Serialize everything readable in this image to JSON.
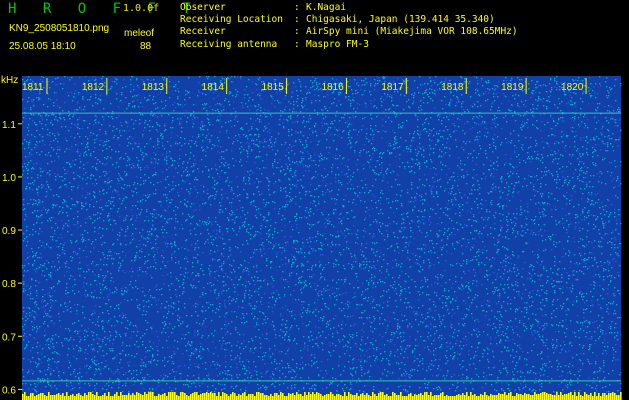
{
  "header": {
    "brand": "H R O F F T",
    "version": "1.0.0f",
    "file_name": "KN9_2508051810.png",
    "mode": "meleof",
    "datetime": "25.08.05 18:10",
    "count": "88"
  },
  "station": [
    {
      "key": "Observer",
      "value": "K.Nagai"
    },
    {
      "key": "Receiving Location",
      "value": "Chigasaki, Japan (139.414 35.340)"
    },
    {
      "key": "Receiver",
      "value": "AirSpy mini (Miakejima VOR 108.65MHz)"
    },
    {
      "key": "Receiving antenna",
      "value": "Maspro FM-3"
    }
  ],
  "chart_data": {
    "type": "heatmap",
    "ylabel": "kHz",
    "ylim": [
      0.58,
      1.19
    ],
    "y_ticks": [
      "1.1",
      "1.0",
      "0.9",
      "0.8",
      "0.7",
      "0.6"
    ],
    "x_ticks": [
      "1811",
      "1812",
      "1813",
      "1814",
      "1815",
      "1816",
      "1817",
      "1818",
      "1819",
      "1820"
    ],
    "palette": {
      "background": "#1040a8",
      "noise": "#00c8d8",
      "strong": "#ffff00",
      "label": "#ffff00"
    }
  }
}
